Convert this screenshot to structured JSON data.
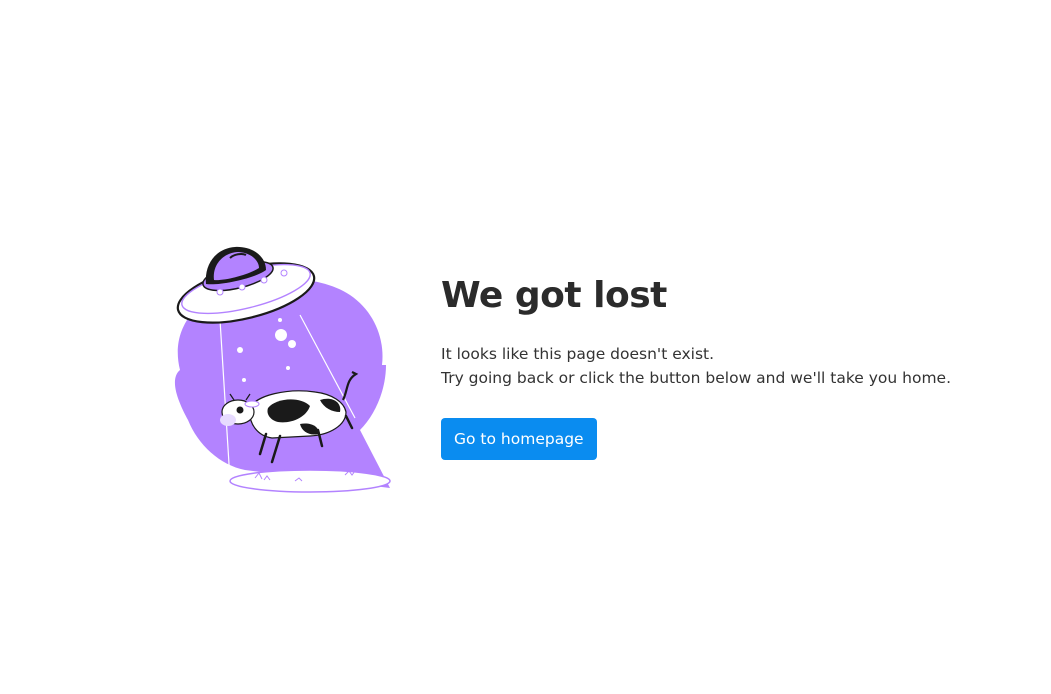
{
  "not_found": {
    "title": "We got lost",
    "message_line1": "It looks like this page doesn't exist.",
    "message_line2": "Try going back or click the button below and we'll take you home.",
    "button_label": "Go to homepage"
  },
  "illustration": {
    "icon": "ufo-abducting-cow-illustration",
    "accent_color": "#b383ff"
  },
  "colors": {
    "button_background": "#0a8cf0",
    "title_text": "#2b2b2b",
    "body_text": "#333333"
  }
}
